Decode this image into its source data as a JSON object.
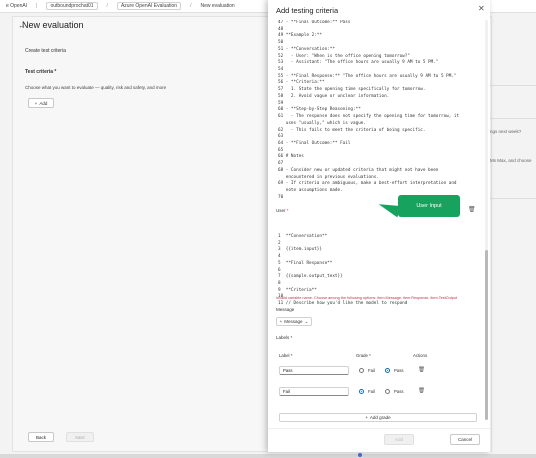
{
  "breadcrumb": {
    "items": [
      "e OpenAI",
      "outboundprochat01",
      "Azure OpenAI Evaluation",
      "New evaluation"
    ]
  },
  "background": {
    "title": "New evaluation",
    "section_title": "Create test criteria",
    "criteria_label": "Test criteria *",
    "criteria_desc": "Choose what you want to evaluate — quality, risk and safety, and more",
    "add_label": "Add",
    "back_label": "Back",
    "next_label": "Next",
    "side_text_1": "ngs next week?",
    "side_text_2": "Ms Max, and choose"
  },
  "dialog": {
    "title": "Add testing criteria",
    "code_lines_top": [
      "47 - **Final Outcome:** Pass",
      "48",
      "49 **Example 2:**",
      "50",
      "51 - **Conversation:**",
      "52   - User: \"When is the office opening tomorrow?\"",
      "53   - Assistant: \"The office hours are usually 9 AM to 5 PM.\"",
      "54",
      "55 - **Final Response:** \"The office hours are usually 9 AM to 5 PM.\"",
      "56 - **Criteria:**",
      "57   1. State the opening time specifically for tomorrow.",
      "58   2. Avoid vague or unclear information.",
      "59",
      "60 - **Step-by-Step Reasoning:**",
      "61   - The response does not specify the opening time for tomorrow, it",
      "   uses \"usually,\" which is vague.",
      "62   - This fails to meet the criteria of being specific.",
      "63",
      "64 - **Final Outcome:** Fail",
      "65",
      "66 # Notes",
      "67",
      "68 - Consider new or updated criteria that might not have been",
      "   encountered in previous evaluations.",
      "69 - If criteria are ambiguous, make a best-effort interpretation and",
      "   note assumptions made.",
      "70"
    ],
    "user_label": "User",
    "tooltip_text": "User Input",
    "code_lines_user": [
      "1  **Conversation**",
      "2",
      "3  {{item.input}}",
      "4",
      "5  **Final Response**",
      "6",
      "7  {{sample.output_text}}",
      "8",
      "9  **Criteria**",
      "10",
      "11 // Describe how you'd like the model to respond"
    ],
    "error_text": "Invalid variable name. Choose among the following options: item.Message, item.Response, item.TestOutput",
    "message_label": "Message",
    "message_button": "Message",
    "labels_label": "Labels *",
    "table": {
      "col_label": "Label *",
      "col_grade": "Grade *",
      "col_actions": "Actions",
      "rows": [
        {
          "label": "Pass",
          "fail": "Fail",
          "pass": "Pass",
          "selected": "pass"
        },
        {
          "label": "Fail",
          "fail": "Fail",
          "pass": "Pass",
          "selected": "fail"
        }
      ]
    },
    "add_grade_label": "Add grade",
    "footer": {
      "add_label": "Add",
      "cancel_label": "Cancel"
    }
  },
  "colors": {
    "accent": "#0f6cbd",
    "tooltip": "#17a35d",
    "error": "#c4314b"
  }
}
